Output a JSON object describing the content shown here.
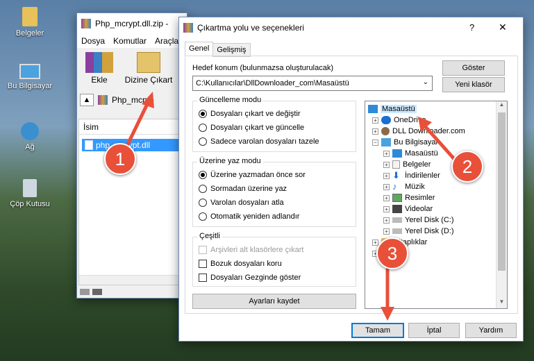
{
  "desktop": {
    "icons": [
      {
        "label": "Belgeler"
      },
      {
        "label": "Bu Bilgisayar"
      },
      {
        "label": "Ağ"
      },
      {
        "label": "Çöp Kutusu"
      }
    ]
  },
  "winrar": {
    "title": "Php_mcrypt.dll.zip -",
    "menu": [
      "Dosya",
      "Komutlar",
      "Araçla"
    ],
    "toolbar": {
      "add_label": "Ekle",
      "extract_label": "Dizine Çıkart"
    },
    "path_text": "Php_mcryp",
    "column_name": "İsim",
    "file_name": "php_mcrypt.dll"
  },
  "dialog": {
    "title": "Çıkartma yolu ve seçenekleri",
    "help_glyph": "?",
    "close_glyph": "✕",
    "tabs": [
      "Genel",
      "Gelişmiş"
    ],
    "dest_label": "Hedef konum (bulunmazsa oluşturulacak)",
    "dest_value": "C:\\Kullanıcılar\\DllDownloader_com\\Masaüstü",
    "show_button": "Göster",
    "new_folder_button": "Yeni klasör",
    "update_mode": {
      "title": "Güncelleme modu",
      "options": [
        "Dosyaları çıkart ve değiştir",
        "Dosyaları çıkart ve güncelle",
        "Sadece varolan dosyaları tazele"
      ]
    },
    "overwrite_mode": {
      "title": "Üzerine yaz modu",
      "options": [
        "Üzerine yazmadan önce sor",
        "Sormadan üzerine yaz",
        "Varolan dosyaları atla",
        "Otomatik yeniden adlandır"
      ]
    },
    "misc": {
      "title": "Çeşitli",
      "options": [
        "Arşivleri alt klasörlere çıkart",
        "Bozuk dosyaları koru",
        "Dosyaları Gezginde göster"
      ]
    },
    "save_settings": "Ayarları kaydet",
    "tree": [
      "Masaüstü",
      "OneDrive",
      "DLL Downloader.com",
      "Bu Bilgisayar",
      "Masaüstü",
      "Belgeler",
      "İndirilenler",
      "Müzik",
      "Resimler",
      "Videolar",
      "Yerel Disk (C:)",
      "Yerel Disk (D:)",
      "Kitaplıklar",
      "Ağ"
    ],
    "ok": "Tamam",
    "cancel": "İptal",
    "help": "Yardım"
  },
  "markers": [
    "1",
    "2",
    "3"
  ],
  "colors": {
    "accent": "#0078d7",
    "marker": "#e8503a",
    "selection": "#cce8ff"
  }
}
